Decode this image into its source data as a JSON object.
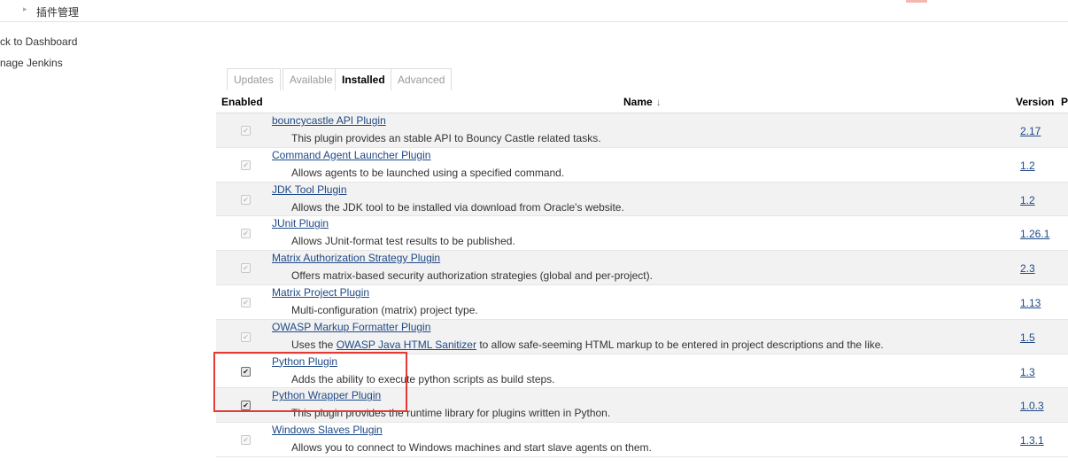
{
  "breadcrumb": {
    "item": "插件管理"
  },
  "sidebar": {
    "items": [
      {
        "label": "ck to Dashboard"
      },
      {
        "label": "nage Jenkins"
      }
    ]
  },
  "tabs": [
    {
      "label": "Updates",
      "active": false
    },
    {
      "label": "Available",
      "active": false
    },
    {
      "label": "Installed",
      "active": true
    },
    {
      "label": "Advanced",
      "active": false
    }
  ],
  "table": {
    "headers": {
      "enabled": "Enabled",
      "name": "Name",
      "sort_indicator": "↓",
      "version": "Version",
      "extra": "P"
    },
    "rows": [
      {
        "name": "bouncycastle API Plugin",
        "desc": "This plugin provides an stable API to Bouncy Castle related tasks.",
        "version": "2.17",
        "enabled": true,
        "editable": false
      },
      {
        "name": "Command Agent Launcher Plugin",
        "desc": "Allows agents to be launched using a specified command.",
        "version": "1.2",
        "enabled": true,
        "editable": false
      },
      {
        "name": "JDK Tool Plugin",
        "desc": "Allows the JDK tool to be installed via download from Oracle's website.",
        "version": "1.2",
        "enabled": true,
        "editable": false
      },
      {
        "name": "JUnit Plugin",
        "desc": "Allows JUnit-format test results to be published.",
        "version": "1.26.1",
        "enabled": true,
        "editable": false
      },
      {
        "name": "Matrix Authorization Strategy Plugin",
        "desc": "Offers matrix-based security authorization strategies (global and per-project).",
        "version": "2.3",
        "enabled": true,
        "editable": false
      },
      {
        "name": "Matrix Project Plugin",
        "desc": "Multi-configuration (matrix) project type.",
        "version": "1.13",
        "enabled": true,
        "editable": false
      },
      {
        "name": "OWASP Markup Formatter Plugin",
        "desc_prefix": "Uses the ",
        "desc_link": "OWASP Java HTML Sanitizer",
        "desc_suffix": " to allow safe-seeming HTML markup to be entered in project descriptions and the like.",
        "version": "1.5",
        "enabled": true,
        "editable": false
      },
      {
        "name": "Python Plugin",
        "desc": "Adds the ability to execute python scripts as build steps.",
        "version": "1.3",
        "enabled": true,
        "editable": true
      },
      {
        "name": "Python Wrapper Plugin",
        "desc": "This plugin provides the runtime library for plugins written in Python.",
        "version": "1.0.3",
        "enabled": true,
        "editable": true
      },
      {
        "name": "Windows Slaves Plugin",
        "desc": "Allows you to connect to Windows machines and start slave agents on them.",
        "version": "1.3.1",
        "enabled": true,
        "editable": false
      }
    ]
  },
  "colors": {
    "highlight": "#e53935",
    "link": "#204a87",
    "row_alt": "#f2f2f2"
  }
}
